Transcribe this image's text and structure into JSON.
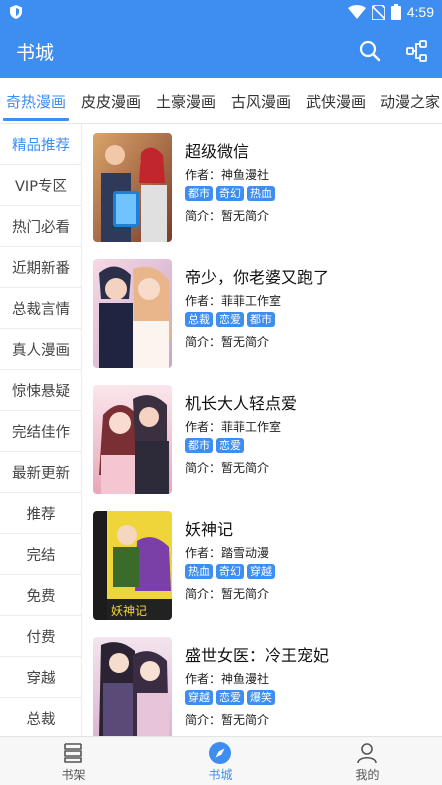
{
  "status_bar": {
    "time": "4:59"
  },
  "app_bar": {
    "title": "书城"
  },
  "tabs": [
    "奇热漫画",
    "皮皮漫画",
    "土豪漫画",
    "古风漫画",
    "武侠漫画",
    "动漫之家"
  ],
  "sidebar": [
    "精品推荐",
    "VIP专区",
    "热门必看",
    "近期新番",
    "总裁言情",
    "真人漫画",
    "惊悚悬疑",
    "完结佳作",
    "最新更新",
    "推荐",
    "完结",
    "免费",
    "付费",
    "穿越",
    "总裁"
  ],
  "books": [
    {
      "title": "超级微信",
      "author": "作者：神鱼漫社",
      "tags": [
        "都市",
        "奇幻",
        "热血"
      ],
      "intro": "简介：暂无简介"
    },
    {
      "title": "帝少，你老婆又跑了",
      "author": "作者：菲菲工作室",
      "tags": [
        "总裁",
        "恋爱",
        "都市"
      ],
      "intro": "简介：暂无简介"
    },
    {
      "title": "机长大人轻点爱",
      "author": "作者：菲菲工作室",
      "tags": [
        "都市",
        "恋爱"
      ],
      "intro": "简介：暂无简介"
    },
    {
      "title": "妖神记",
      "author": "作者：踏雪动漫",
      "tags": [
        "热血",
        "奇幻",
        "穿越"
      ],
      "intro": "简介：暂无简介"
    },
    {
      "title": "盛世女医：冷王宠妃",
      "author": "作者：神鱼漫社",
      "tags": [
        "穿越",
        "恋爱",
        "爆笑"
      ],
      "intro": "简介：暂无简介"
    }
  ],
  "bottom_nav": [
    "书架",
    "书城",
    "我的"
  ],
  "colors": {
    "accent": "#3d8ef0"
  }
}
